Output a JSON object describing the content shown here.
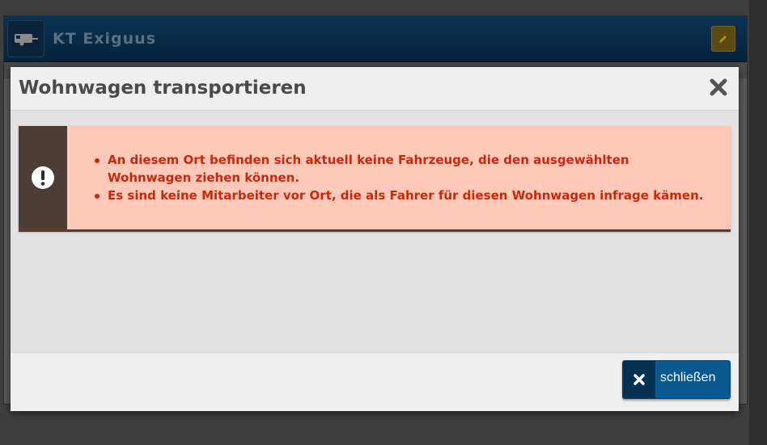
{
  "background": {
    "app_title": "KT Exiguus",
    "vehicle_icon": "trailer-icon",
    "edit_icon": "pencil-icon"
  },
  "modal": {
    "title": "Wohnwagen transportieren",
    "close_icon": "close-icon",
    "alert": {
      "icon": "exclamation-icon",
      "messages": [
        "An diesem Ort befinden sich aktuell keine Fahrzeuge, die den ausgewählten Wohnwagen ziehen können.",
        "Es sind keine Mitarbeiter vor Ort, die als Fahrer für diesen Wohnwagen infrage kämen."
      ]
    },
    "footer": {
      "close_button_label": "schließen",
      "close_button_icon": "close-icon"
    }
  },
  "colors": {
    "alert_background": "#ffc9b9",
    "alert_text": "#c8290c",
    "alert_side": "#4e3d35",
    "primary_button": "#0a5890",
    "header_blue": "#05233c"
  }
}
